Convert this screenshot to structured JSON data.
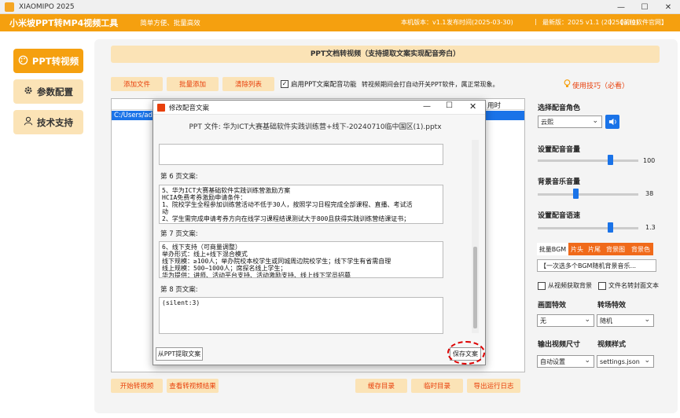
{
  "window": {
    "title": "XIAOMIPO 2025",
    "min": "—",
    "max": "☐",
    "close": "✕"
  },
  "header": {
    "app_name": "小米坡PPT转MP4视频工具",
    "slogan": "简单方便、批量高效",
    "version": "本机版本：v1.1",
    "release_date": "发布时间(2025-03-30)",
    "latest": "最新版：2025 v1.1 (20250330)",
    "site_link": "【前往软件官网】"
  },
  "nav": [
    {
      "label": "PPT转视频",
      "icon": "palette-icon"
    },
    {
      "label": "参数配置",
      "icon": "gear-icon"
    },
    {
      "label": "技术支持",
      "icon": "user-icon"
    }
  ],
  "banner": "PPT文档转视频（支持提取文案实现配音旁白）",
  "toolbar": {
    "add_file": "添加文件",
    "batch_add": "批量添加",
    "clear_list": "清除列表",
    "enable_dub": "启用PPT文案配音功能",
    "hint": "转视频期间会打自动开关PPT软件，属正常现象。",
    "tips": "使用技巧（必看）"
  },
  "file_list": {
    "col_time": "用时",
    "row_path": "C:/Users/adm"
  },
  "bottom_buttons": {
    "start": "开始转视频",
    "view_result": "查看转视频结果",
    "cache_dir": "缓存目录",
    "temp_dir": "临时目录",
    "export_log": "导出运行日志"
  },
  "right": {
    "voice_label": "选择配音角色",
    "voice_value": "云熙",
    "volume_label": "设置配音音量",
    "volume_value": "100",
    "volume_level": 0.72,
    "bgm_label": "背景音乐音量",
    "bgm_value": "38",
    "bgm_level": 0.38,
    "speed_label": "设置配音语速",
    "speed_value": "1.3",
    "speed_level": 0.72,
    "tabs": [
      "批量BGM",
      "片头",
      "片尾",
      "背景图",
      "背景色"
    ],
    "bgm_random": "【一次选多个BGM随机背景音乐...",
    "from_video_bg": "从视频获取背景",
    "filename_cover": "文件名转封面文本",
    "transition_label": "画面特效",
    "transition_value": "无",
    "switch_label": "转场特效",
    "switch_value": "随机",
    "size_label": "输出视频尺寸",
    "size_value": "自动设置",
    "style_label": "视频样式",
    "style_value": "settings.json"
  },
  "dialog": {
    "title": "修改配音文案",
    "ppt_file": "PPT 文件: 华为ICT大赛基础软件实践训练营+线下-20240710临中国区(1).pptx",
    "page6_label": "第 6 页文案:",
    "page6_text": "5、华为ICT大赛基础软件实践训练营激励方案\nHCIA免费考券激励申请条件：\n1、院校学生全程参加训练营活动不低于30人，按照学习日程完成全部课程、直播、考试活\n动\n2、学生需完成申请考券方向在线学习课程结课测试大于800且获得实践训练营结课证书；",
    "page7_label": "第 7 页文案:",
    "page7_text": "6、线下支持（可商量调整）\n举办形式：线上+线下混合模式\n线下规模：≥100人；举办院校本校学生或同城周边院校学生；线下学生有省需自理\n线上规模：500~1000人；席探名线上学生；\n华为提供：讲师、活动平台支持、活动激励支持、线上线下学员招募",
    "page8_label": "第 8 页文案:",
    "page8_text": "(silent:3)",
    "extract_btn": "从PPT提取文案",
    "save_btn": "保存文案"
  }
}
